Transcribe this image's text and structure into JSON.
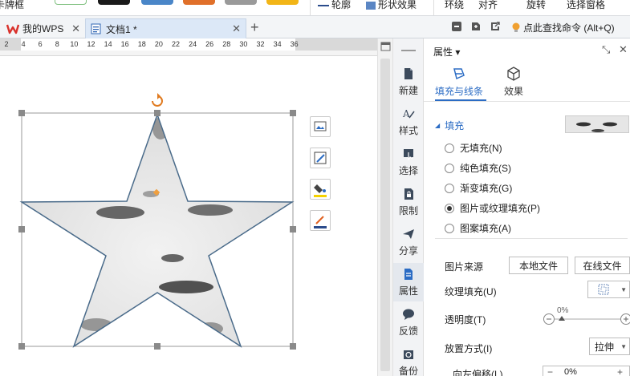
{
  "ribbon": {
    "left_label": "卡牌框",
    "right_labels": [
      "轮廓",
      "形状效果",
      "环绕",
      "对齐",
      "旋转",
      "选择窗格"
    ]
  },
  "tabs": {
    "home": "我的WPS",
    "doc": "文档1 *",
    "new_tab": "+",
    "search_command": "点此查找命令 (Alt+Q)"
  },
  "ruler": {
    "numbers": [
      "2",
      "4",
      "6",
      "8",
      "10",
      "12",
      "14",
      "16",
      "18",
      "20",
      "22",
      "24",
      "26",
      "28",
      "30",
      "32",
      "34",
      "36"
    ]
  },
  "sidenav": {
    "items": [
      {
        "label": "新建",
        "icon": "new-doc-icon"
      },
      {
        "label": "样式",
        "icon": "style-icon"
      },
      {
        "label": "选择",
        "icon": "select-icon"
      },
      {
        "label": "限制",
        "icon": "lock-doc-icon"
      },
      {
        "label": "分享",
        "icon": "share-icon"
      },
      {
        "label": "属性",
        "icon": "property-icon"
      },
      {
        "label": "反馈",
        "icon": "feedback-icon"
      },
      {
        "label": "备份",
        "icon": "backup-icon"
      }
    ],
    "active": "属性"
  },
  "panel": {
    "title": "属性 ▾",
    "tabs": {
      "fill": "填充与线条",
      "effect": "效果"
    },
    "fill_header": "填充",
    "fill_options": [
      {
        "label": "无填充(N)",
        "selected": false
      },
      {
        "label": "纯色填充(S)",
        "selected": false
      },
      {
        "label": "渐变填充(G)",
        "selected": false
      },
      {
        "label": "图片或纹理填充(P)",
        "selected": true
      },
      {
        "label": "图案填充(A)",
        "selected": false
      }
    ],
    "picture_source_label": "图片来源",
    "local_file_button": "本地文件",
    "online_file_button": "在线文件",
    "texture_fill_label": "纹理填充(U)",
    "transparency_label": "透明度(T)",
    "transparency_value": "0%",
    "placement_label": "放置方式(I)",
    "placement_value": "拉伸",
    "offset_left_label": "向左偏移(L)",
    "offset_left_value": "0%"
  },
  "colors": {
    "accent": "#2b6cc4",
    "tab_active": "#dce8f7",
    "handle": "#888888",
    "rotate_handle": "#e07a1f",
    "star_outline": "#4a6b8a"
  }
}
